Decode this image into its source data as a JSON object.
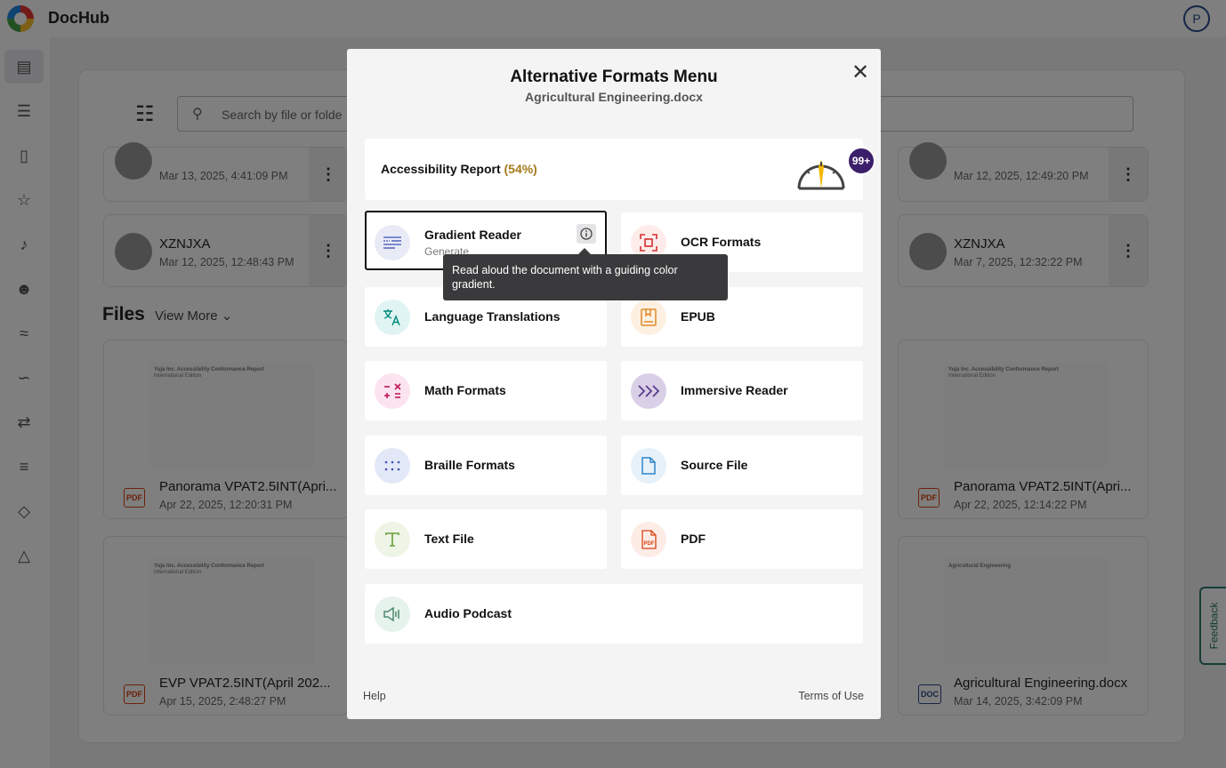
{
  "app": {
    "brand": "DocHub",
    "avatar_initial": "P",
    "search": {
      "placeholder": "Search by file or folde"
    },
    "folders": [
      {
        "name": "",
        "date": "Mar 13, 2025, 4:41:09 PM"
      },
      {
        "name": "",
        "date": "Mar 12, 2025, 12:49:20 PM"
      },
      {
        "name": "XZNJXA",
        "date": "Mar 12, 2025, 12:48:43 PM"
      },
      {
        "name": "XZNJXA",
        "date": "Mar 7, 2025, 12:32:22 PM"
      }
    ],
    "files_heading": "Files",
    "view_more": "View More",
    "files": [
      {
        "name": "Panorama VPAT2.5INT(Apri...",
        "date": "Apr 22, 2025, 12:20:31 PM",
        "type": "PDF"
      },
      {
        "name": "Panorama VPAT2.5INT(Apri...",
        "date": "Apr 22, 2025, 12:14:22 PM",
        "type": "PDF"
      },
      {
        "name": "EVP VPAT2.5INT(April 202...",
        "date": "Apr 15, 2025, 2:48:27 PM",
        "type": "PDF"
      },
      {
        "name": "Agricultural Engineering.docx",
        "date": "Mar 14, 2025, 3:42:09 PM",
        "type": "DOC"
      }
    ],
    "thumb_title": "Yuja Inc. Accessibility Conformance Report",
    "thumb_subtitle": "International Edition",
    "thumb_doc_title": "Agricultural Engineering",
    "feedback": "Feedback"
  },
  "modal": {
    "title": "Alternative Formats Menu",
    "subtitle": "Agricultural Engineering.docx",
    "close_icon": "close-icon",
    "accessibility": {
      "label": "Accessibility Report",
      "percent": "(54%)",
      "percent_color": "#a67c1b",
      "badge": "99+"
    },
    "options": [
      {
        "id": "gradient-reader",
        "label": "Gradient Reader",
        "sub": "Generate",
        "icon": "gradient-reader-icon",
        "color": "#5b6abf",
        "bg": "#e8eaf6"
      },
      {
        "id": "ocr-formats",
        "label": "OCR Formats",
        "icon": "ocr-icon",
        "color": "#d32f2f",
        "bg": "#fdecea"
      },
      {
        "id": "language-translations",
        "label": "Language Translations",
        "icon": "translate-icon",
        "color": "#00897b",
        "bg": "#e0f4f3"
      },
      {
        "id": "epub",
        "label": "EPUB",
        "icon": "epub-icon",
        "color": "#e08a2a",
        "bg": "#fdf0e1"
      },
      {
        "id": "math-formats",
        "label": "Math Formats",
        "icon": "math-icon",
        "color": "#c2185b",
        "bg": "#fbe4f0"
      },
      {
        "id": "immersive-reader",
        "label": "Immersive Reader",
        "icon": "immersive-reader-icon",
        "color": "#5a3d8a",
        "bg": "#d9cfe6"
      },
      {
        "id": "braille-formats",
        "label": "Braille Formats",
        "icon": "braille-icon",
        "color": "#3f51b5",
        "bg": "#e3e8f8"
      },
      {
        "id": "source-file",
        "label": "Source File",
        "icon": "file-icon",
        "color": "#2f86c9",
        "bg": "#e6f1fa"
      },
      {
        "id": "text-file",
        "label": "Text File",
        "icon": "text-icon",
        "color": "#689f38",
        "bg": "#eef4e6"
      },
      {
        "id": "pdf",
        "label": "PDF",
        "icon": "pdf-icon",
        "color": "#d84315",
        "bg": "#fdece6"
      },
      {
        "id": "audio-podcast",
        "label": "Audio Podcast",
        "icon": "audio-icon",
        "color": "#4f8a6d",
        "bg": "#e6f2ec"
      }
    ],
    "tooltip": "Read aloud the document with a guiding color gradient.",
    "help": "Help",
    "terms": "Terms of Use"
  }
}
